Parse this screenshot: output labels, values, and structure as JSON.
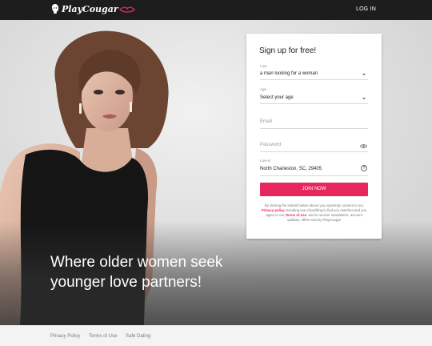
{
  "header": {
    "logo_text": "PlayCougar",
    "login_label": "LOG IN"
  },
  "hero": {
    "tagline_line1": "Where older women seek",
    "tagline_line2": "younger love partners!"
  },
  "signup": {
    "title": "Sign up for free!",
    "i_am_label": "I am",
    "i_am_value": "a man looking for a woman",
    "age_label": "Age",
    "age_value": "Select your age",
    "email_placeholder": "Email",
    "password_placeholder": "Password",
    "location_label": "Live in",
    "location_value": "North Charleston, SC, 29405",
    "help_symbol": "?",
    "join_label": "JOIN NOW",
    "consent_part1": "By clicking the submit button above you expressly consent to our",
    "privacy_link": "Privacy policy",
    "consent_part2": "including use of profiling to find you matches and you agree to our",
    "terms_link": "Terms of use",
    "consent_part3": ", and to receive newsletters, account updates, offers sent by PlayCougar"
  },
  "footer": {
    "links": [
      "Privacy Policy",
      "Terms of Use",
      "Safe Dating"
    ]
  },
  "colors": {
    "accent": "#e8265e",
    "topbar": "#1d1d1d"
  }
}
